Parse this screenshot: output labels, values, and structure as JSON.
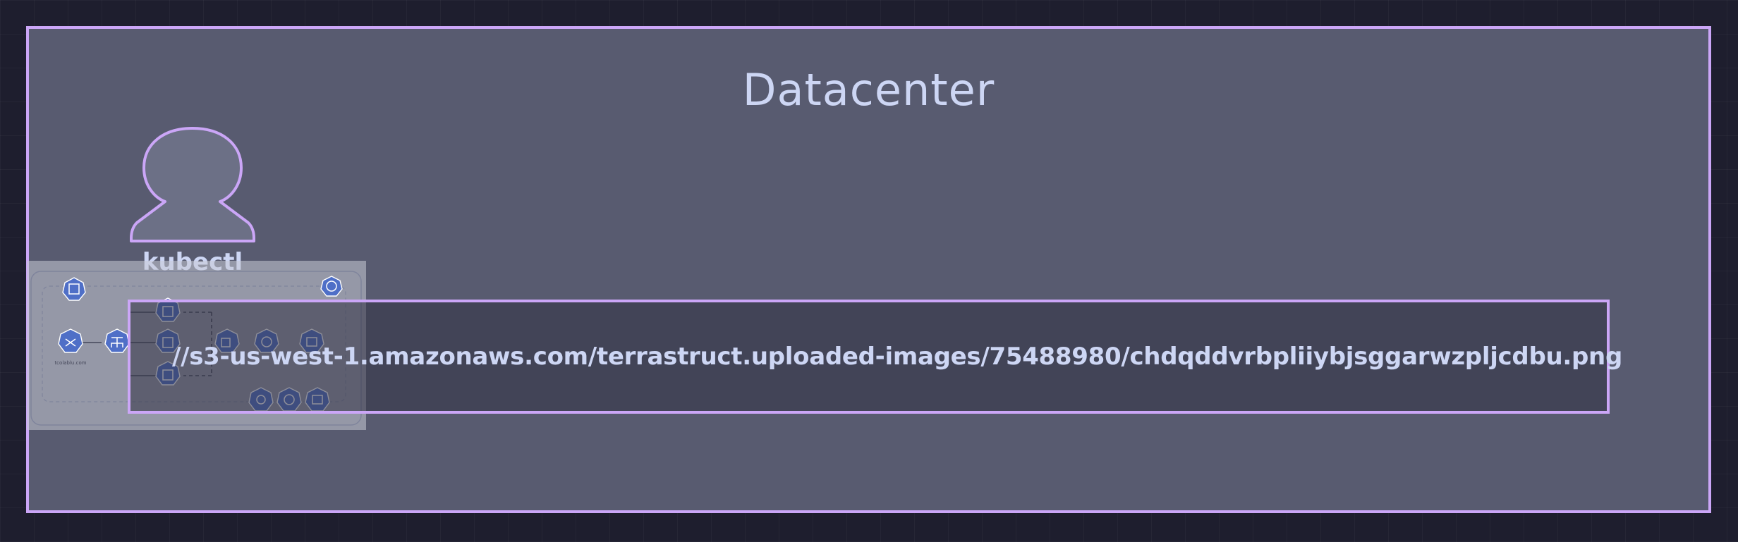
{
  "diagram": {
    "container": {
      "label": "Datacenter",
      "stroke_color": "#cba6f7",
      "fill_color": "#585b70"
    },
    "nodes": [
      {
        "id": "kubectl",
        "label": "kubectl",
        "shape": "person"
      },
      {
        "id": "image",
        "label": "//s3-us-west-1.amazonaws.com/terrastruct.uploaded-images/75488980/chdqddvrbpliiybjsggarwzpljcdbu.png",
        "shape": "rectangle"
      }
    ],
    "embedded_image": {
      "description_icons": [
        "ingress-icon",
        "service-icon",
        "pod-icon",
        "deployment-icon",
        "replicaset-icon",
        "hpa-icon",
        "configmap-icon",
        "kubernetes-icon"
      ],
      "caption": "tcolablu.com"
    }
  }
}
